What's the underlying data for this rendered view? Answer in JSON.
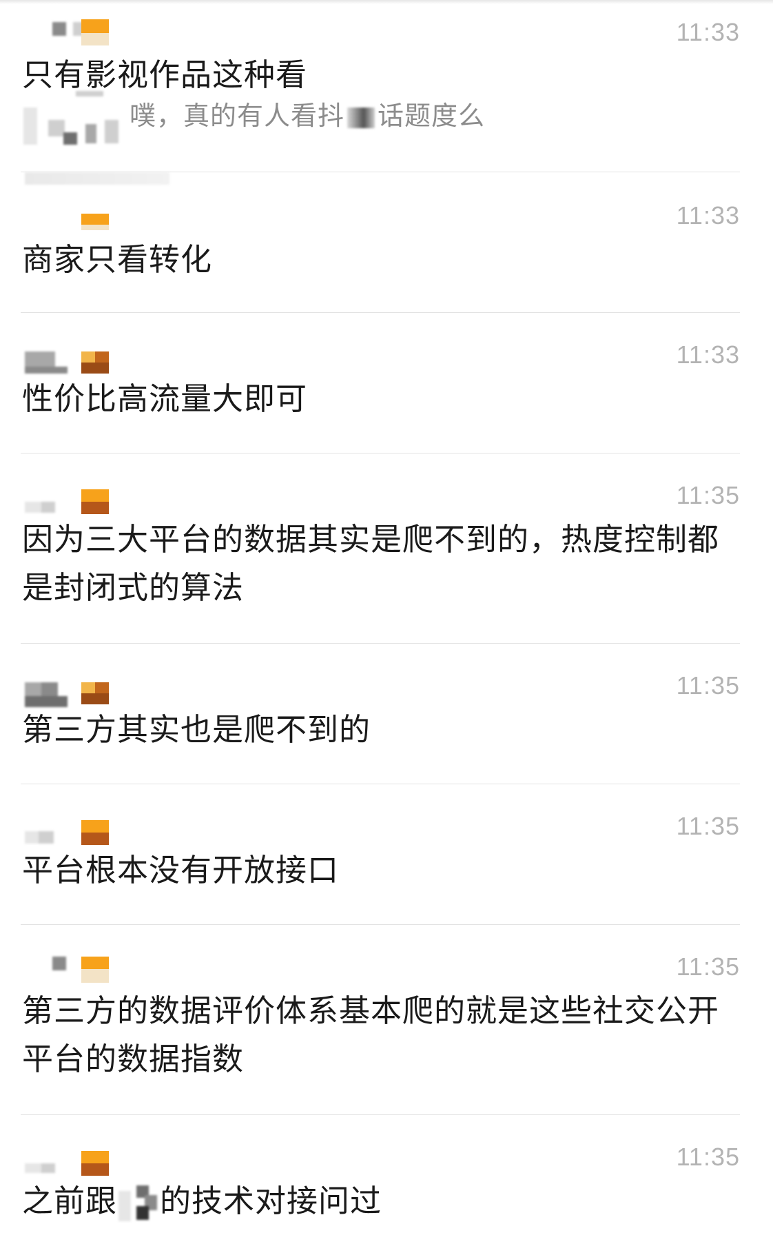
{
  "messages": [
    {
      "time": "11:33",
      "text": "只有影视作品这种看",
      "quote_before": "噗，真的有人看抖",
      "quote_after": "话题度么"
    },
    {
      "time": "11:33",
      "text": "商家只看转化"
    },
    {
      "time": "11:33",
      "text": "性价比高流量大即可"
    },
    {
      "time": "11:35",
      "text": "因为三大平台的数据其实是爬不到的，热度控制都是封闭式的算法"
    },
    {
      "time": "11:35",
      "text": "第三方其实也是爬不到的"
    },
    {
      "time": "11:35",
      "text": "平台根本没有开放接口"
    },
    {
      "time": "11:35",
      "text": "第三方的数据评价体系基本爬的就是这些社交公开平台的数据指数"
    },
    {
      "time": "11:35",
      "text_before": "之前跟",
      "text_after": "的技术对接问过"
    }
  ],
  "colors": {
    "time": "#b3b3b3",
    "text": "#1a1a1a",
    "quote": "#8c8c8c",
    "divider": "#e3e3e3",
    "badge_orange": "#f7a21b",
    "badge_brown": "#9a4b16"
  }
}
